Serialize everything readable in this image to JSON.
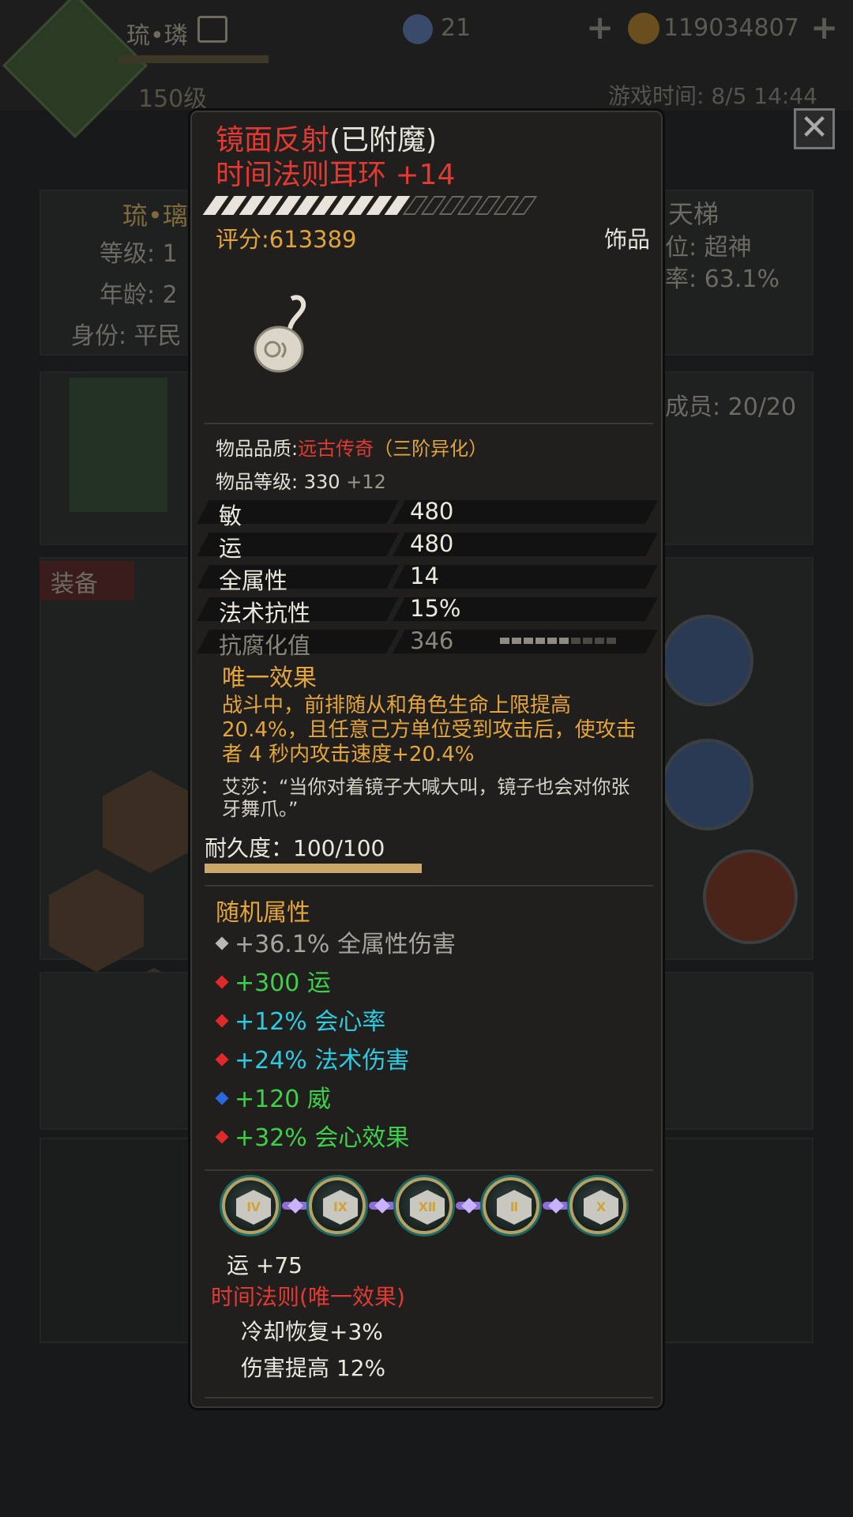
{
  "background": {
    "player_name": "琉•璘",
    "level": "150级",
    "gems": "21",
    "coins": "119034807",
    "game_time": "游戏时间: 8/5 14:44",
    "profile": {
      "name": "琉•璃",
      "level_label": "等级: 1",
      "age_label": "年龄: 2",
      "identity_label": "身份: 平民",
      "ladder_label": "天梯",
      "rank_label": "位: 超神",
      "rate_label": "率: 63.1%"
    },
    "guild_members": "成员: 20/20",
    "equipment_tab": "装备"
  },
  "item": {
    "name": "镜面反射",
    "enchant_tag": "(已附魔)",
    "subtitle": "时间法则耳环 +14",
    "score_label": "评分:613389",
    "score_fraction": 0.6,
    "category": "饰品",
    "icon": "gourd-earring-icon",
    "quality_label": "物品品质:",
    "quality_value": "远古传奇",
    "quality_suffix": "（三阶异化）",
    "level_label": "物品等级:",
    "level_value": "330",
    "level_bonus": "+12",
    "attributes": [
      {
        "name": "敏",
        "value": "480"
      },
      {
        "name": "运",
        "value": "480"
      },
      {
        "name": "全属性",
        "value": "14"
      },
      {
        "name": "法术抗性",
        "value": "15%"
      },
      {
        "name": "抗腐化值",
        "value": "346"
      }
    ],
    "corruption_segments_filled": 6,
    "corruption_segments_total": 10,
    "unique_title": "唯一效果",
    "unique_text": "战斗中，前排随从和角色生命上限提高 20.4%，且任意己方单位受到攻击后，使攻击者 4 秒内攻击速度+20.4%",
    "quote": "艾莎：“当你对着镜子大喊大叫，镜子也会对你张牙舞爪。”",
    "durability_label": "耐久度：100/100",
    "durability_fraction": 1.0,
    "random_title": "随机属性",
    "random_attributes": [
      {
        "text": "+36.1% 全属性伤害",
        "color": "#a9a59c",
        "dot": "#b8b8b8"
      },
      {
        "text": "+300 运",
        "color": "#3fcf4a",
        "dot": "#e02a2a"
      },
      {
        "text": "+12% 会心率",
        "color": "#2fc9e0",
        "dot": "#e02a2a"
      },
      {
        "text": "+24% 法术伤害",
        "color": "#2fc9e0",
        "dot": "#e02a2a"
      },
      {
        "text": "+120 威",
        "color": "#3fcf4a",
        "dot": "#2a6ae0"
      },
      {
        "text": "+32% 会心效果",
        "color": "#3fcf4a",
        "dot": "#e02a2a"
      }
    ],
    "runes": [
      "rune-1-icon",
      "rune-2-icon",
      "rune-3-icon",
      "rune-4-icon",
      "rune-5-icon"
    ],
    "rune_bonus": "运  +75",
    "set_title": "时间法则",
    "set_tag": "(唯一效果)",
    "set_effects": [
      "冷却恢复+3%",
      "伤害提高 12%"
    ]
  },
  "close_icon": "close-icon"
}
